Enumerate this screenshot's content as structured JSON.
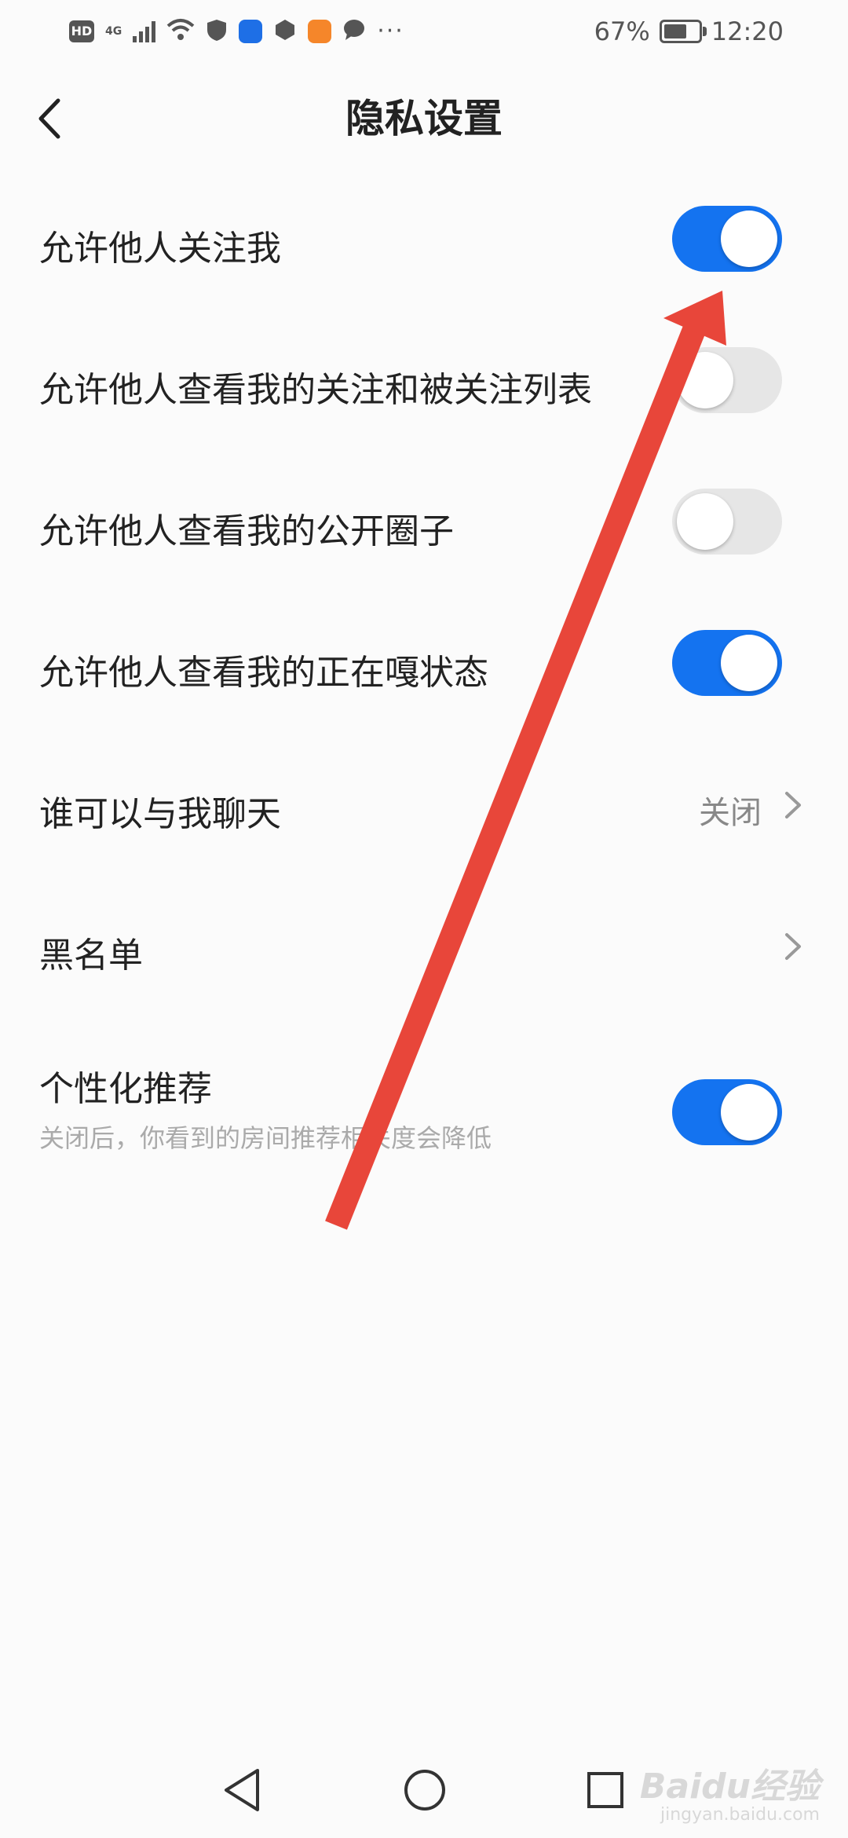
{
  "status_bar": {
    "hd": "HD",
    "signal": "4G",
    "battery_percent": "67%",
    "battery_level": 0.67,
    "time": "12:20",
    "more": "···",
    "app_icon_colors": [
      "#555555",
      "#1e6fe6",
      "#555555",
      "#f5862a",
      "#555555"
    ]
  },
  "header": {
    "title": "隐私设置"
  },
  "settings": [
    {
      "label": "允许他人关注我",
      "type": "toggle",
      "on": true
    },
    {
      "label": "允许他人查看我的关注和被关注列表",
      "type": "toggle",
      "on": false
    },
    {
      "label": "允许他人查看我的公开圈子",
      "type": "toggle",
      "on": false
    },
    {
      "label": "允许他人查看我的正在嘎状态",
      "type": "toggle",
      "on": true
    },
    {
      "label": "谁可以与我聊天",
      "type": "link",
      "value": "关闭"
    },
    {
      "label": "黑名单",
      "type": "link",
      "value": ""
    },
    {
      "label": "个性化推荐",
      "sub": "关闭后，你看到的房间推荐相关度会降低",
      "type": "toggle",
      "on": true
    }
  ],
  "colors": {
    "toggle_on": "#1473f0",
    "toggle_off": "#e6e6e6",
    "annotation_arrow": "#e8463a"
  },
  "icons": {
    "back": "chevron-left-icon",
    "chevron": "chevron-right-icon",
    "nav_back": "triangle-back-icon",
    "nav_home": "circle-home-icon",
    "nav_recent": "square-recent-icon"
  },
  "watermark": {
    "brand": "Baidu经验",
    "url": "jingyan.baidu.com"
  }
}
